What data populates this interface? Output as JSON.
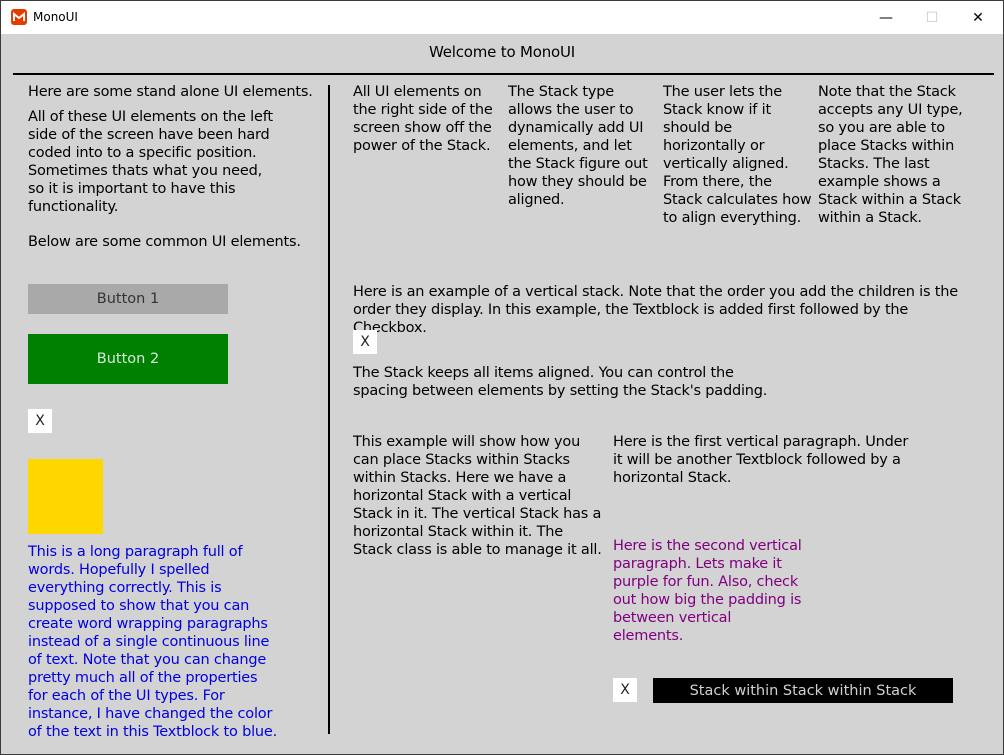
{
  "window": {
    "title": "MonoUI",
    "icon": "monogame-logo-icon",
    "controls": {
      "minimize": "—",
      "maximize": "☐",
      "close": "✕"
    }
  },
  "header": {
    "title": "Welcome to MonoUI"
  },
  "left": {
    "intro": "Here are some stand alone UI elements.",
    "para1": "All of these UI elements on the left side of the screen have been hard coded into to a specific position. Sometimes thats what you need, so it is important to have this functionality.",
    "para2": "Below are some common UI elements.",
    "button1_label": "Button 1",
    "button2_label": "Button 2",
    "checkbox_mark": "X",
    "swatch_color": "#ffd700",
    "blue_paragraph": "This is a long paragraph full of words. Hopefully I spelled everything correctly. This is supposed to show that you can create word wrapping paragraphs instead of a single continuous line of text. Note that you can change pretty much all of the properties for each of the UI types. For instance, I have changed the color of the text in this Textblock to blue."
  },
  "right": {
    "columns": [
      "All UI elements on the right side of the screen show off the power of the Stack.",
      "The Stack type allows the user to dynamically add UI elements, and let the Stack figure out how they should be aligned.",
      "The user lets the Stack know if it should be horizontally or vertically aligned. From there, the Stack calculates how to align everything.",
      "Note that the Stack accepts any UI type, so you are able to place Stacks within Stacks. The last example shows a Stack within a Stack within a Stack."
    ],
    "vertical_example": "Here is an example of a vertical stack. Note that the order you add the children is the order they display. In this example, the Textblock is added first followed by the Checkbox.",
    "checkbox_mark": "X",
    "aligned_note": "The Stack keeps all items aligned. You can control the spacing between elements by setting the Stack's padding.",
    "nested_example": "This example will show how you can place Stacks within Stacks within Stacks. Here we have a horizontal Stack with a vertical Stack in it. The vertical Stack has a horizontal Stack within it. The Stack class is able to manage it all.",
    "first_vertical": "Here is the first vertical paragraph. Under it will be another Textblock followed by a horizontal Stack.",
    "second_vertical": "Here is the second vertical paragraph. Lets make it purple for fun. Also, check out how big the padding is between vertical elements.",
    "inner_checkbox_mark": "X",
    "inner_button_label": "Stack within Stack within Stack"
  },
  "colors": {
    "background": "#d3d3d3",
    "button1": "#a9a9a9",
    "button2": "#008000",
    "blue_text": "#0000e0",
    "purple_text": "#800080",
    "inner_button": "#000000"
  }
}
